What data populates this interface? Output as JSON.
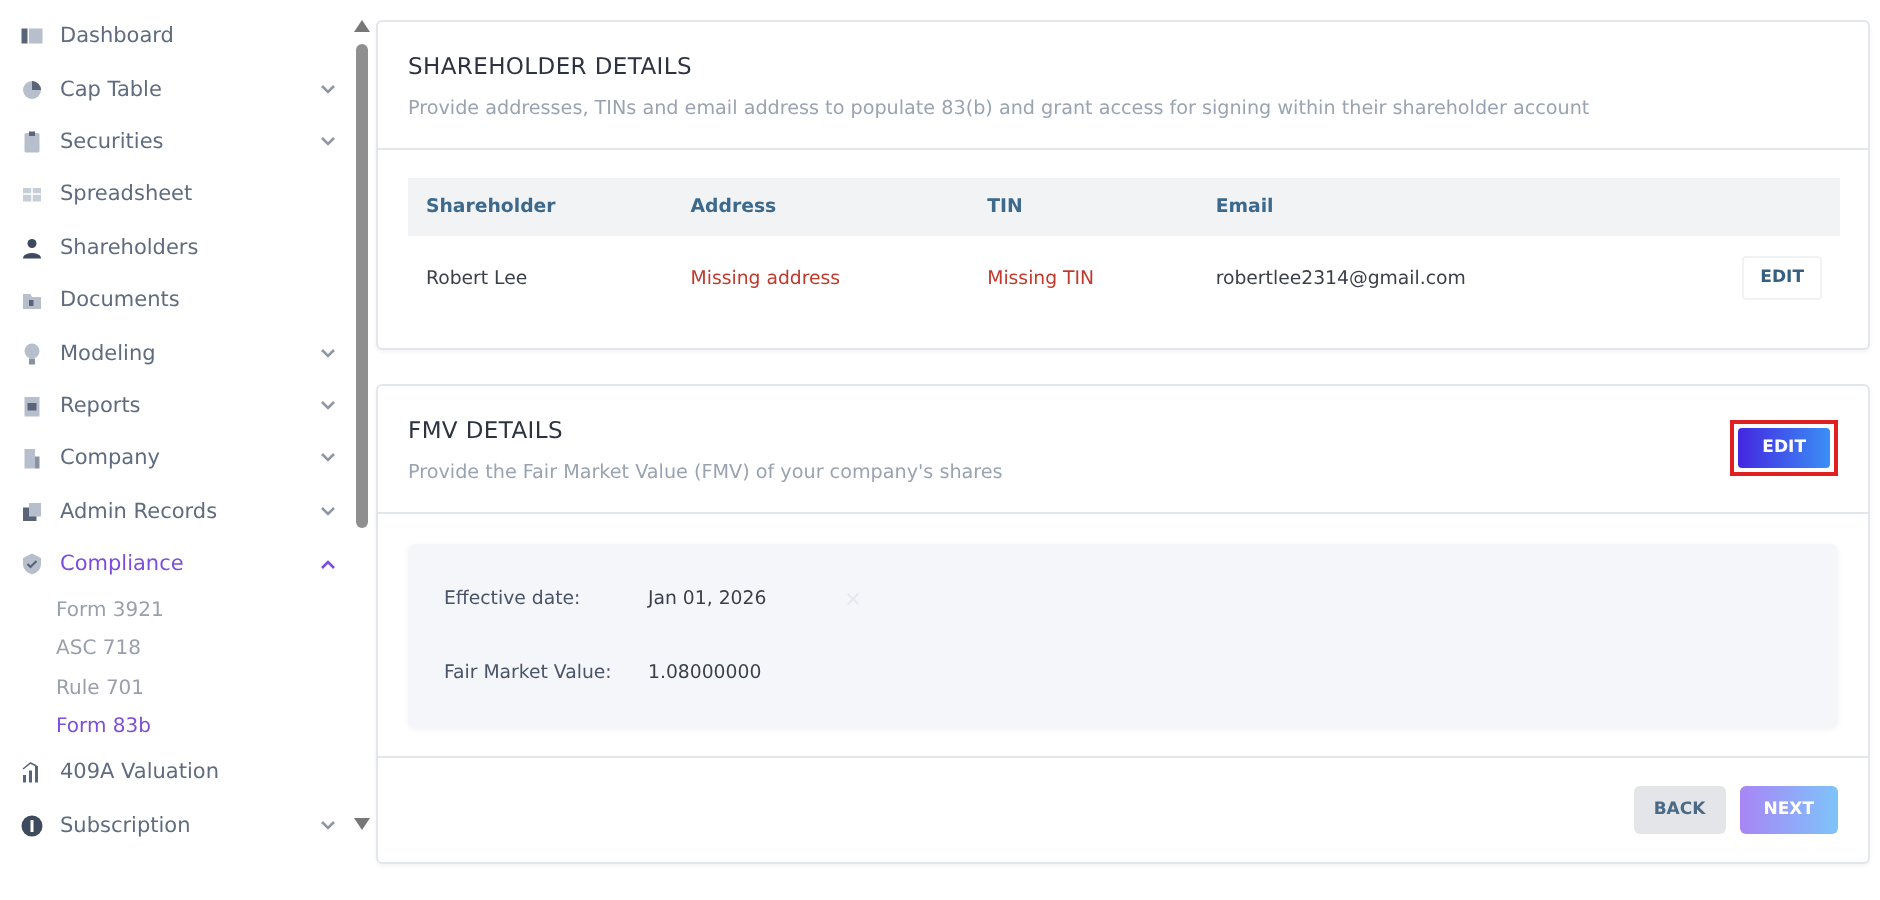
{
  "sidebar": {
    "items": [
      {
        "label": "Dashboard",
        "expandable": false,
        "selected": false
      },
      {
        "label": "Cap Table",
        "expandable": true,
        "expanded": false,
        "selected": false
      },
      {
        "label": "Securities",
        "expandable": true,
        "expanded": false,
        "selected": false
      },
      {
        "label": "Spreadsheet",
        "expandable": false,
        "selected": false
      },
      {
        "label": "Shareholders",
        "expandable": false,
        "selected": false
      },
      {
        "label": "Documents",
        "expandable": false,
        "selected": false
      },
      {
        "label": "Modeling",
        "expandable": true,
        "expanded": false,
        "selected": false
      },
      {
        "label": "Reports",
        "expandable": true,
        "expanded": false,
        "selected": false
      },
      {
        "label": "Company",
        "expandable": true,
        "expanded": false,
        "selected": false
      },
      {
        "label": "Admin Records",
        "expandable": true,
        "expanded": false,
        "selected": false
      },
      {
        "label": "Compliance",
        "expandable": true,
        "expanded": true,
        "selected": true,
        "children": [
          {
            "label": "Form 3921",
            "selected": false
          },
          {
            "label": "ASC 718",
            "selected": false
          },
          {
            "label": "Rule 701",
            "selected": false
          },
          {
            "label": "Form 83b",
            "selected": true
          }
        ]
      },
      {
        "label": "409A Valuation",
        "expandable": false,
        "selected": false
      },
      {
        "label": "Subscription",
        "expandable": true,
        "expanded": false,
        "selected": false
      }
    ]
  },
  "shareholder_details": {
    "title": "SHAREHOLDER DETAILS",
    "description": "Provide addresses, TINs and email address to populate 83(b) and grant access for signing within their shareholder account",
    "table": {
      "columns": [
        "Shareholder",
        "Address",
        "TIN",
        "Email"
      ],
      "rows": [
        {
          "cells": [
            {
              "text": "Robert Lee",
              "missing": false
            },
            {
              "text": "Missing address",
              "missing": true
            },
            {
              "text": "Missing TIN",
              "missing": true
            },
            {
              "text": "robertlee2314@gmail.com",
              "missing": false
            }
          ],
          "action": "EDIT"
        }
      ]
    }
  },
  "fmv_details": {
    "title": "FMV DETAILS",
    "description": "Provide the Fair Market Value (FMV) of your company's shares",
    "edit_button": {
      "label": "EDIT",
      "highlighted": true
    },
    "fields": [
      {
        "label": "Effective date:",
        "value": "Jan 01, 2026",
        "clearable": true
      },
      {
        "label": "Fair Market Value:",
        "value": "1.08000000",
        "clearable": false
      }
    ]
  },
  "footer": {
    "buttons": [
      {
        "label": "BACK",
        "kind": "secondary"
      },
      {
        "label": "NEXT",
        "kind": "primary"
      }
    ]
  }
}
